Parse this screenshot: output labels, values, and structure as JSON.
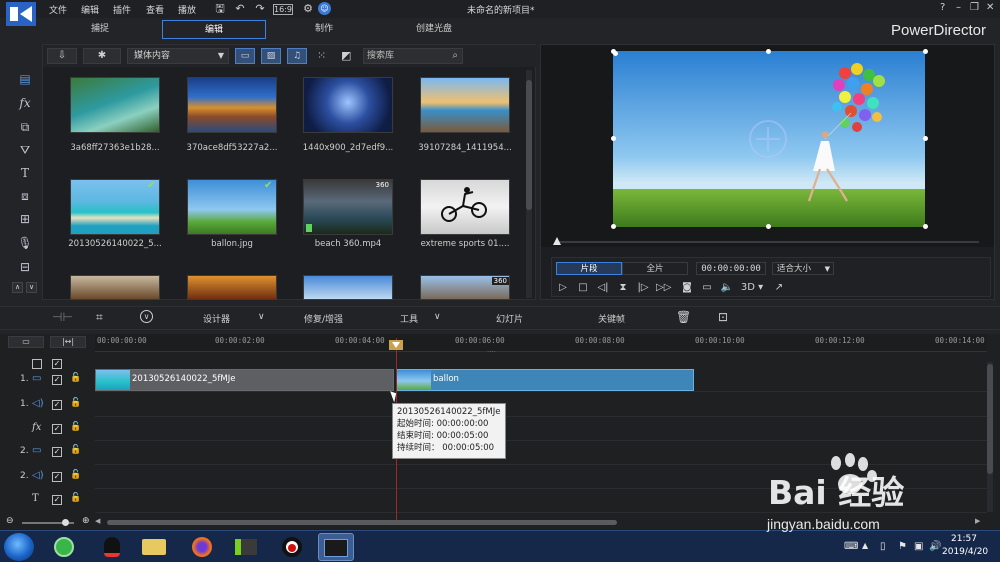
{
  "window": {
    "project_title": "未命名的新项目*",
    "brand": "PowerDirector",
    "menu": [
      "文件",
      "编辑",
      "插件",
      "查看",
      "播放"
    ],
    "controls": {
      "help": "?",
      "minimize": "–",
      "restore": "❐",
      "close": "✕"
    }
  },
  "mode_tabs": [
    {
      "label": "捕捉",
      "active": false
    },
    {
      "label": "编辑",
      "active": true
    },
    {
      "label": "制作",
      "active": false
    },
    {
      "label": "创建光盘",
      "active": false
    }
  ],
  "library": {
    "media_select": "媒体内容",
    "search_placeholder": "搜索库",
    "items": [
      {
        "caption": "3a68ff27363e1b28...",
        "used": false,
        "badge": ""
      },
      {
        "caption": "370ace8df53227a2...",
        "used": false,
        "badge": ""
      },
      {
        "caption": "1440x900_2d7edf9...",
        "used": false,
        "badge": ""
      },
      {
        "caption": "39107284_1411954...",
        "used": false,
        "badge": ""
      },
      {
        "caption": "20130526140022_5...",
        "used": true,
        "badge": ""
      },
      {
        "caption": "ballon.jpg",
        "used": true,
        "badge": ""
      },
      {
        "caption": "beach 360.mp4",
        "used": false,
        "badge": "360"
      },
      {
        "caption": "extreme sports 01....",
        "used": false,
        "badge": ""
      },
      {
        "caption": "",
        "used": false,
        "badge": ""
      },
      {
        "caption": "",
        "used": false,
        "badge": ""
      },
      {
        "caption": "",
        "used": false,
        "badge": ""
      },
      {
        "caption": "",
        "used": false,
        "badge": "360"
      }
    ]
  },
  "preview": {
    "mode_clip": "片段",
    "mode_full": "全片",
    "timecode": "00:00:00:00",
    "fit": "适合大小",
    "three_d": "3D"
  },
  "edit_toolbar": {
    "designer": "设计器",
    "fix_enhance": "修复/增强",
    "tools": "工具",
    "slideshow": "幻灯片",
    "keyframe": "关键帧"
  },
  "timeline": {
    "ruler": [
      "00:00:00:00",
      "00:00:02:00",
      "00:00:04:00",
      "00:00:06:00",
      "00:00:08:00",
      "00:00:10:00",
      "00:00:12:00",
      "00:00:14:00"
    ],
    "tracks": [
      {
        "num": "1.",
        "kind": "video"
      },
      {
        "num": "1.",
        "kind": "audio"
      },
      {
        "num": "",
        "kind": "fx"
      },
      {
        "num": "2.",
        "kind": "video"
      },
      {
        "num": "2.",
        "kind": "audio"
      },
      {
        "num": "",
        "kind": "title"
      }
    ],
    "clips": [
      {
        "label": "20130526140022_5fMJe"
      },
      {
        "label": "ballon"
      }
    ],
    "tooltip": {
      "name": "20130526140022_5fMJe",
      "start": "起始时间: 00:00:00:00",
      "end": "结束时间: 00:00:05:00",
      "duration": "持续时间： 00:00:05:00"
    }
  },
  "taskbar": {
    "time": "21:57",
    "date": "2019/4/20"
  },
  "watermark": {
    "text": "Bai 经验",
    "url": "jingyan.baidu.com"
  }
}
